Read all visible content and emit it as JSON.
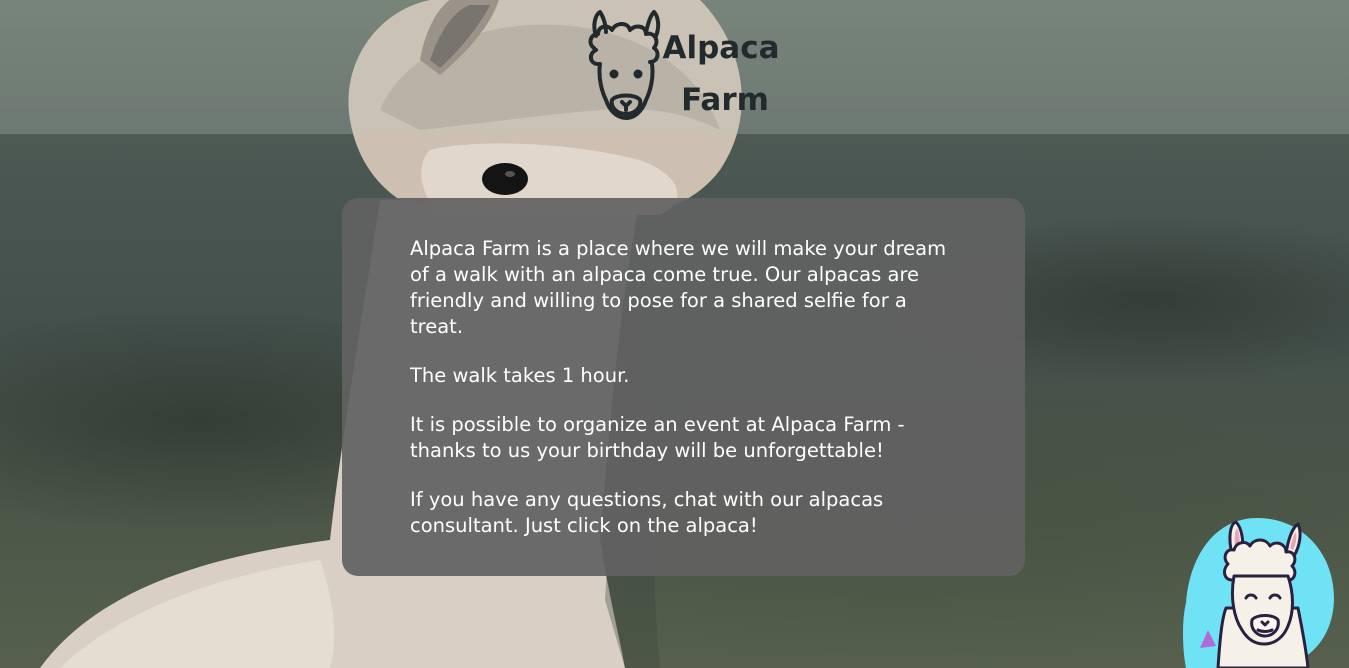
{
  "header": {
    "logo_icon": "alpaca-head-icon",
    "logo_line1": "Alpaca",
    "logo_line2": "Farm"
  },
  "content": {
    "paragraphs": [
      "Alpaca Farm is a place where we will make your dream of a walk with an alpaca come true. Our alpacas are friendly and willing to pose for a shared selfie for a treat.",
      "The walk takes 1 hour.",
      "It is possible to organize an event at Alpaca Farm - thanks to us your birthday will be unforgettable!",
      "If you have any questions, chat with our alpacas consultant. Just click on the alpaca!"
    ]
  },
  "chat": {
    "icon": "alpaca-chat-icon",
    "bubble_color": "#6fe3f5"
  },
  "colors": {
    "panel_bg": "#626262",
    "logo_text": "#222a2e",
    "panel_text": "#ffffff"
  }
}
